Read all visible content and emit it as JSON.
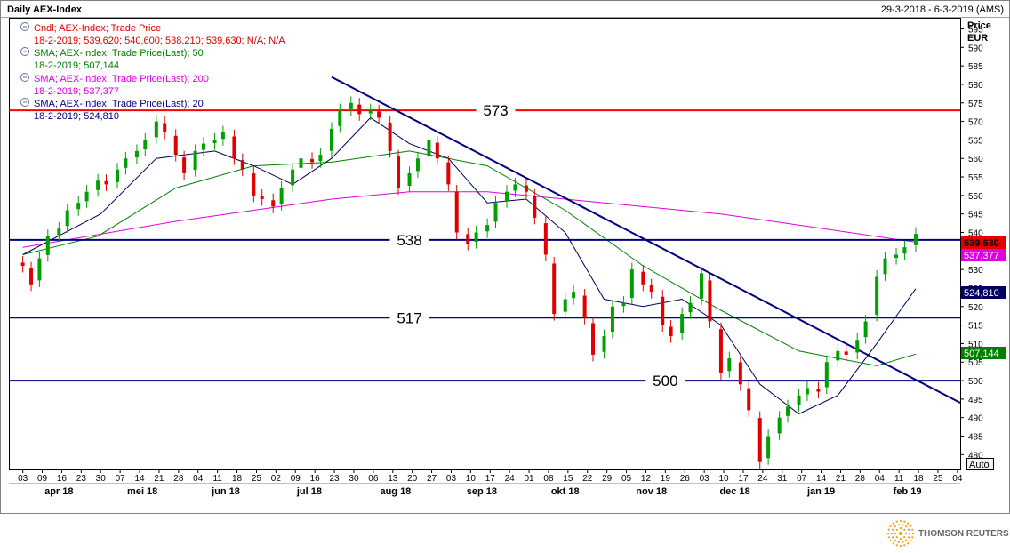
{
  "header": {
    "title": "Daily AEX-Index",
    "date_range": "29-3-2018 - 6-3-2019 (AMS)"
  },
  "legend": [
    {
      "name": "Cndl; AEX-Index; Trade Price",
      "detail": "18-2-2019; 539,620; 540,600; 538,210; 539,630; N/A; N/A",
      "color": "#e00000"
    },
    {
      "name": "SMA; AEX-Index; Trade Price(Last); 50",
      "detail": "18-2-2019; 507,144",
      "color": "#008000"
    },
    {
      "name": "SMA; AEX-Index; Trade Price(Last); 200",
      "detail": "18-2-2019; 537,377",
      "color": "#e000e0"
    },
    {
      "name": "SMA; AEX-Index; Trade Price(Last); 20",
      "detail": "18-2-2019; 524,810",
      "color": "#000080"
    }
  ],
  "axis": {
    "price_label": "Price",
    "currency_label": "EUR",
    "auto_button": "Auto",
    "y_ticks": [
      "595",
      "590",
      "585",
      "580",
      "575",
      "570",
      "565",
      "560",
      "555",
      "550",
      "545",
      "540",
      "535",
      "530",
      "525",
      "520",
      "515",
      "510",
      "505",
      "500",
      "495",
      "490",
      "485",
      "480"
    ],
    "day_ticks": [
      "03",
      "09",
      "16",
      "23",
      "30",
      "07",
      "14",
      "21",
      "28",
      "04",
      "11",
      "18",
      "25",
      "02",
      "09",
      "16",
      "23",
      "30",
      "06",
      "13",
      "20",
      "27",
      "03",
      "10",
      "17",
      "24",
      "01",
      "08",
      "15",
      "22",
      "29",
      "05",
      "12",
      "19",
      "26",
      "03",
      "10",
      "17",
      "24",
      "31",
      "07",
      "14",
      "21",
      "28",
      "04",
      "11",
      "18",
      "25",
      "04"
    ],
    "month_ticks": [
      "apr 18",
      "mei 18",
      "jun 18",
      "jul 18",
      "aug 18",
      "sep 18",
      "okt 18",
      "nov 18",
      "dec 18",
      "jan 19",
      "feb 19"
    ]
  },
  "value_badges": {
    "close": "539,630",
    "sma200": "537,377",
    "sma20": "524,810",
    "sma50": "507,144"
  },
  "levels": [
    {
      "label": "573",
      "value": 573
    },
    {
      "label": "538",
      "value": 538
    },
    {
      "label": "517",
      "value": 517
    },
    {
      "label": "500",
      "value": 500
    }
  ],
  "brand": "THOMSON REUTERS",
  "colors": {
    "up_candle": "#00a000",
    "down_candle": "#e00000",
    "resistance": "#ff0000",
    "support": "#000080",
    "trendline": "#000080",
    "sma20": "#000060",
    "sma50": "#008000",
    "sma200": "#e000e0"
  },
  "chart_data": {
    "type": "candlestick",
    "title": "Daily AEX-Index",
    "ylabel": "Price EUR",
    "ylim": [
      476,
      598
    ],
    "x_range": [
      "2018-03-29",
      "2019-03-06"
    ],
    "grid": false,
    "horizontal_levels": [
      573,
      538,
      517,
      500
    ],
    "trendline": {
      "from": {
        "date": "2018-07-23",
        "value": 582
      },
      "to": {
        "date": "2019-03-06",
        "value": 494
      }
    },
    "last_candle": {
      "date": "2019-02-18",
      "open": 539.62,
      "high": 540.6,
      "low": 538.21,
      "close": 539.63
    },
    "series": [
      {
        "name": "Cndl; AEX-Index; Trade Price",
        "type": "candlestick",
        "points": [
          {
            "d": "2018-04-03",
            "c": 531
          },
          {
            "d": "2018-04-06",
            "c": 526
          },
          {
            "d": "2018-04-09",
            "c": 533
          },
          {
            "d": "2018-04-12",
            "c": 539
          },
          {
            "d": "2018-04-16",
            "c": 541
          },
          {
            "d": "2018-04-19",
            "c": 546
          },
          {
            "d": "2018-04-23",
            "c": 548
          },
          {
            "d": "2018-04-26",
            "c": 551
          },
          {
            "d": "2018-04-30",
            "c": 554
          },
          {
            "d": "2018-05-03",
            "c": 553
          },
          {
            "d": "2018-05-07",
            "c": 557
          },
          {
            "d": "2018-05-10",
            "c": 560
          },
          {
            "d": "2018-05-14",
            "c": 562
          },
          {
            "d": "2018-05-17",
            "c": 565
          },
          {
            "d": "2018-05-21",
            "c": 570
          },
          {
            "d": "2018-05-24",
            "c": 567
          },
          {
            "d": "2018-05-28",
            "c": 561
          },
          {
            "d": "2018-05-31",
            "c": 556
          },
          {
            "d": "2018-06-04",
            "c": 562
          },
          {
            "d": "2018-06-07",
            "c": 564
          },
          {
            "d": "2018-06-11",
            "c": 565
          },
          {
            "d": "2018-06-14",
            "c": 567
          },
          {
            "d": "2018-06-18",
            "c": 560
          },
          {
            "d": "2018-06-21",
            "c": 557
          },
          {
            "d": "2018-06-25",
            "c": 550
          },
          {
            "d": "2018-06-28",
            "c": 549
          },
          {
            "d": "2018-07-02",
            "c": 547
          },
          {
            "d": "2018-07-05",
            "c": 552
          },
          {
            "d": "2018-07-09",
            "c": 557
          },
          {
            "d": "2018-07-12",
            "c": 560
          },
          {
            "d": "2018-07-16",
            "c": 559
          },
          {
            "d": "2018-07-19",
            "c": 561
          },
          {
            "d": "2018-07-23",
            "c": 568
          },
          {
            "d": "2018-07-26",
            "c": 573
          },
          {
            "d": "2018-07-30",
            "c": 575
          },
          {
            "d": "2018-08-02",
            "c": 572
          },
          {
            "d": "2018-08-06",
            "c": 573
          },
          {
            "d": "2018-08-09",
            "c": 571
          },
          {
            "d": "2018-08-13",
            "c": 562
          },
          {
            "d": "2018-08-16",
            "c": 552
          },
          {
            "d": "2018-08-20",
            "c": 556
          },
          {
            "d": "2018-08-23",
            "c": 560
          },
          {
            "d": "2018-08-27",
            "c": 565
          },
          {
            "d": "2018-08-30",
            "c": 560
          },
          {
            "d": "2018-09-03",
            "c": 553
          },
          {
            "d": "2018-09-06",
            "c": 540
          },
          {
            "d": "2018-09-10",
            "c": 537
          },
          {
            "d": "2018-09-13",
            "c": 540
          },
          {
            "d": "2018-09-17",
            "c": 542
          },
          {
            "d": "2018-09-20",
            "c": 548
          },
          {
            "d": "2018-09-24",
            "c": 551
          },
          {
            "d": "2018-09-27",
            "c": 553
          },
          {
            "d": "2018-10-01",
            "c": 551
          },
          {
            "d": "2018-10-04",
            "c": 544
          },
          {
            "d": "2018-10-08",
            "c": 534
          },
          {
            "d": "2018-10-11",
            "c": 518
          },
          {
            "d": "2018-10-15",
            "c": 522
          },
          {
            "d": "2018-10-18",
            "c": 524
          },
          {
            "d": "2018-10-22",
            "c": 517
          },
          {
            "d": "2018-10-25",
            "c": 507
          },
          {
            "d": "2018-10-29",
            "c": 512
          },
          {
            "d": "2018-11-01",
            "c": 520
          },
          {
            "d": "2018-11-05",
            "c": 521
          },
          {
            "d": "2018-11-08",
            "c": 530
          },
          {
            "d": "2018-11-12",
            "c": 526
          },
          {
            "d": "2018-11-15",
            "c": 524
          },
          {
            "d": "2018-11-19",
            "c": 515
          },
          {
            "d": "2018-11-22",
            "c": 512
          },
          {
            "d": "2018-11-26",
            "c": 518
          },
          {
            "d": "2018-11-29",
            "c": 521
          },
          {
            "d": "2018-12-03",
            "c": 529
          },
          {
            "d": "2018-12-06",
            "c": 516
          },
          {
            "d": "2018-12-10",
            "c": 502
          },
          {
            "d": "2018-12-13",
            "c": 506
          },
          {
            "d": "2018-12-17",
            "c": 499
          },
          {
            "d": "2018-12-20",
            "c": 492
          },
          {
            "d": "2018-12-24",
            "c": 478
          },
          {
            "d": "2018-12-27",
            "c": 485
          },
          {
            "d": "2018-12-31",
            "c": 490
          },
          {
            "d": "2019-01-03",
            "c": 493
          },
          {
            "d": "2019-01-07",
            "c": 496
          },
          {
            "d": "2019-01-10",
            "c": 498
          },
          {
            "d": "2019-01-14",
            "c": 497
          },
          {
            "d": "2019-01-17",
            "c": 505
          },
          {
            "d": "2019-01-21",
            "c": 508
          },
          {
            "d": "2019-01-24",
            "c": 507
          },
          {
            "d": "2019-01-28",
            "c": 511
          },
          {
            "d": "2019-01-31",
            "c": 516
          },
          {
            "d": "2019-02-04",
            "c": 528
          },
          {
            "d": "2019-02-07",
            "c": 533
          },
          {
            "d": "2019-02-11",
            "c": 534
          },
          {
            "d": "2019-02-14",
            "c": 536
          },
          {
            "d": "2019-02-18",
            "c": 539.63
          }
        ]
      },
      {
        "name": "SMA; AEX-Index; Trade Price(Last); 20",
        "points": [
          [
            "2018-04-03",
            534
          ],
          [
            "2018-05-01",
            545
          ],
          [
            "2018-05-21",
            560
          ],
          [
            "2018-06-11",
            562
          ],
          [
            "2018-06-25",
            558
          ],
          [
            "2018-07-09",
            553
          ],
          [
            "2018-07-23",
            560
          ],
          [
            "2018-08-06",
            571
          ],
          [
            "2018-08-20",
            564
          ],
          [
            "2018-09-03",
            560
          ],
          [
            "2018-09-17",
            548
          ],
          [
            "2018-10-01",
            549
          ],
          [
            "2018-10-15",
            540
          ],
          [
            "2018-10-29",
            522
          ],
          [
            "2018-11-12",
            520
          ],
          [
            "2018-11-26",
            522
          ],
          [
            "2018-12-10",
            515
          ],
          [
            "2018-12-24",
            499
          ],
          [
            "2019-01-07",
            491
          ],
          [
            "2019-01-21",
            496
          ],
          [
            "2019-02-04",
            510
          ],
          [
            "2019-02-18",
            524.81
          ]
        ]
      },
      {
        "name": "SMA; AEX-Index; Trade Price(Last); 50",
        "points": [
          [
            "2018-04-03",
            534
          ],
          [
            "2018-04-30",
            539
          ],
          [
            "2018-05-28",
            552
          ],
          [
            "2018-06-25",
            558
          ],
          [
            "2018-07-23",
            559
          ],
          [
            "2018-08-20",
            562
          ],
          [
            "2018-09-17",
            558
          ],
          [
            "2018-10-15",
            546
          ],
          [
            "2018-11-12",
            531
          ],
          [
            "2018-12-10",
            519
          ],
          [
            "2019-01-07",
            508
          ],
          [
            "2019-02-04",
            504
          ],
          [
            "2019-02-18",
            507.144
          ]
        ]
      },
      {
        "name": "SMA; AEX-Index; Trade Price(Last); 200",
        "points": [
          [
            "2018-04-03",
            536
          ],
          [
            "2018-05-28",
            543
          ],
          [
            "2018-07-23",
            549
          ],
          [
            "2018-08-20",
            551
          ],
          [
            "2018-09-17",
            551
          ],
          [
            "2018-10-15",
            549
          ],
          [
            "2018-11-12",
            547
          ],
          [
            "2018-12-10",
            545
          ],
          [
            "2019-01-07",
            542
          ],
          [
            "2019-02-18",
            537.377
          ]
        ]
      }
    ]
  }
}
